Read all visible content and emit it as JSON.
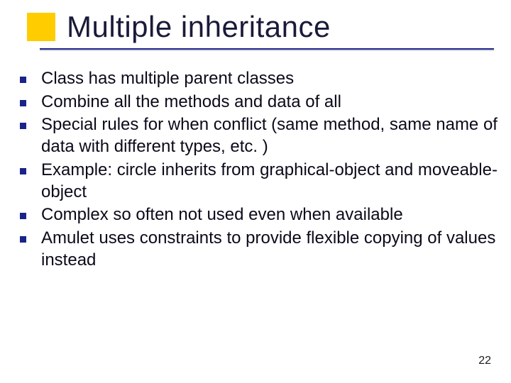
{
  "slide": {
    "title": "Multiple inheritance",
    "bullets": [
      "Class has multiple parent classes",
      "Combine all the methods and data of all",
      "Special rules for when conflict (same method, same name of data with different types, etc. )",
      "Example: circle inherits from graphical-object and moveable-object",
      "Complex so often not used even when available",
      "Amulet uses constraints to provide flexible copying of values instead"
    ],
    "page_number": "22"
  }
}
